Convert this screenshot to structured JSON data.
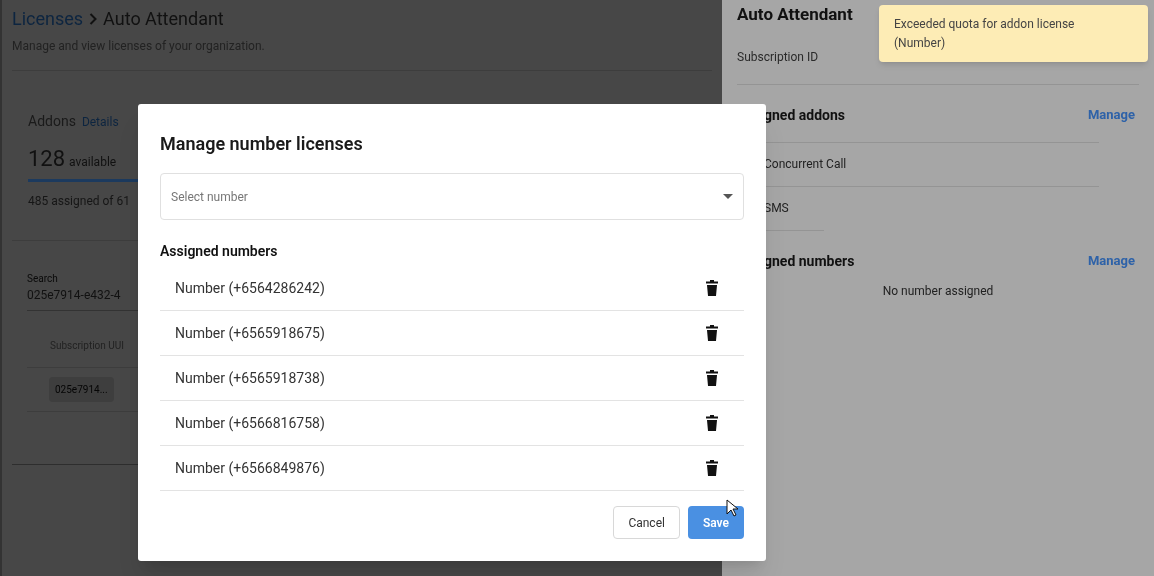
{
  "page": {
    "breadcrumb": {
      "parent": "Licenses",
      "current": "Auto Attendant"
    },
    "subtitle": "Manage and view licenses of your organization.",
    "addons": {
      "title": "Addons",
      "details_link": "Details",
      "count": "128",
      "count_label": "available",
      "assigned": "485 assigned of 61"
    },
    "search": {
      "label": "Search",
      "value": "025e7914-e432-4"
    },
    "table": {
      "columns": [
        "Subscription UUI"
      ],
      "rows": [
        [
          "025e7914..."
        ]
      ]
    }
  },
  "drawer": {
    "title": "Auto Attendant",
    "subscription_label": "Subscription ID",
    "sections": [
      {
        "heading": "gned addons",
        "action": "Manage",
        "items": [
          "Concurrent Call",
          "SMS"
        ]
      },
      {
        "heading": "gned numbers",
        "action": "Manage",
        "empty": "No number assigned"
      }
    ]
  },
  "toast": {
    "message": "Exceeded quota for addon license (Number)"
  },
  "dialog": {
    "title": "Manage number licenses",
    "select": {
      "placeholder": "Select number"
    },
    "list_heading": "Assigned numbers",
    "numbers": [
      "Number (+6564286242)",
      "Number (+6565918675)",
      "Number (+6565918738)",
      "Number (+6566816758)",
      "Number (+6566849876)"
    ],
    "buttons": {
      "cancel": "Cancel",
      "save": "Save"
    }
  }
}
